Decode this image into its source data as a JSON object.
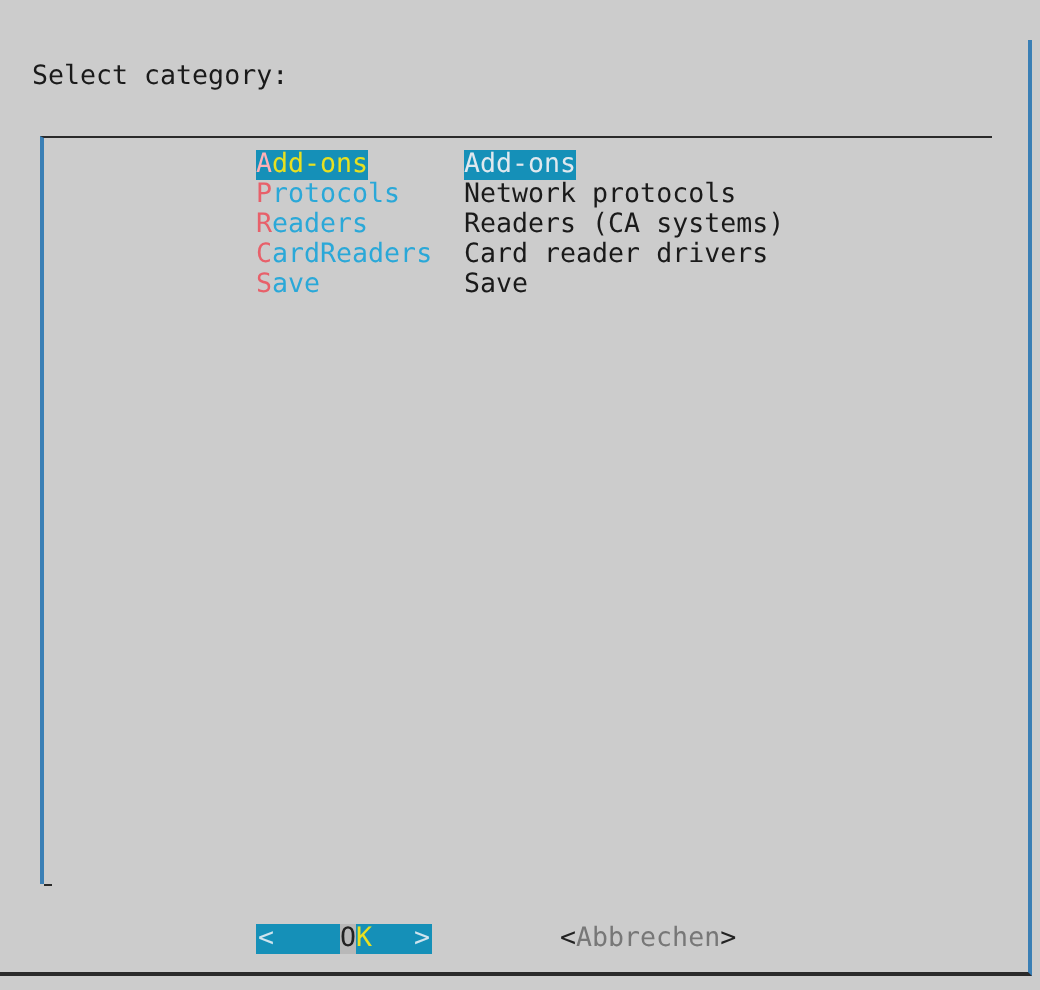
{
  "prompt": "Select category:",
  "menu": [
    {
      "tag": "Add-ons",
      "description": "Add-ons",
      "selected": true
    },
    {
      "tag": "Protocols",
      "description": "Network protocols",
      "selected": false
    },
    {
      "tag": "Readers",
      "description": "Readers (CA systems)",
      "selected": false
    },
    {
      "tag": "CardReaders",
      "description": "Card reader drivers",
      "selected": false
    },
    {
      "tag": "Save",
      "description": "Save",
      "selected": false
    }
  ],
  "buttons": [
    {
      "left": "<",
      "label": "OK",
      "right": ">",
      "selected": true
    },
    {
      "left": "<",
      "label": "Abbrechen",
      "right": ">",
      "selected": false
    }
  ]
}
